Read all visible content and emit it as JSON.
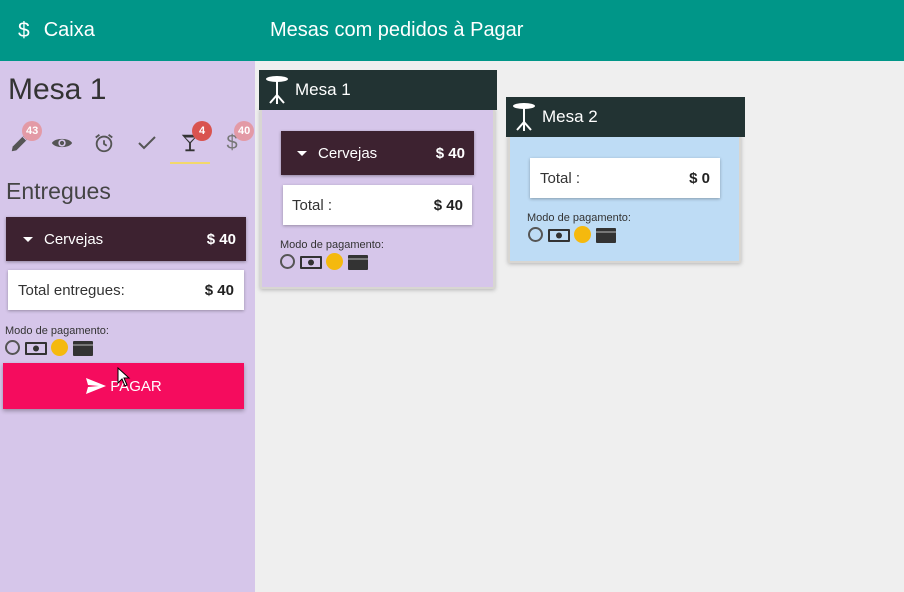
{
  "app": {
    "title": "Caixa",
    "icon": "dollar-icon"
  },
  "header": {
    "title": "Mesas com pedidos à Pagar"
  },
  "sidebar": {
    "mesa_title": "Mesa 1",
    "tabs": [
      {
        "icon": "pencil-icon",
        "badge": "43"
      },
      {
        "icon": "eye-icon",
        "badge": ""
      },
      {
        "icon": "alarm-clock-icon",
        "badge": ""
      },
      {
        "icon": "check-icon",
        "badge": ""
      },
      {
        "icon": "cocktail-icon",
        "badge": "4",
        "selected": true
      },
      {
        "icon": "dollar-icon",
        "badge": "40"
      }
    ],
    "section_title": "Entregues",
    "item": {
      "name": "Cervejas",
      "amount": "$ 40"
    },
    "total": {
      "label": "Total entregues:",
      "amount": "$ 40"
    },
    "payment_label": "Modo de pagamento:",
    "pay_button": "PAGAR"
  },
  "tables": [
    {
      "name": "Mesa 1",
      "item": {
        "name": "Cervejas",
        "amount": "$ 40"
      },
      "total": {
        "label": "Total :",
        "amount": "$ 40"
      },
      "payment_label": "Modo de pagamento:",
      "color": "#d6c6ea"
    },
    {
      "name": "Mesa 2",
      "total": {
        "label": "Total :",
        "amount": "$ 0"
      },
      "payment_label": "Modo de pagamento:",
      "color": "#bedcf5"
    }
  ],
  "colors": {
    "primary": "#009688",
    "accent": "#f50c5e",
    "item_bg": "#3d2230",
    "card_header": "#223333",
    "badge": "#d9534f",
    "coin": "#f5b90e"
  }
}
